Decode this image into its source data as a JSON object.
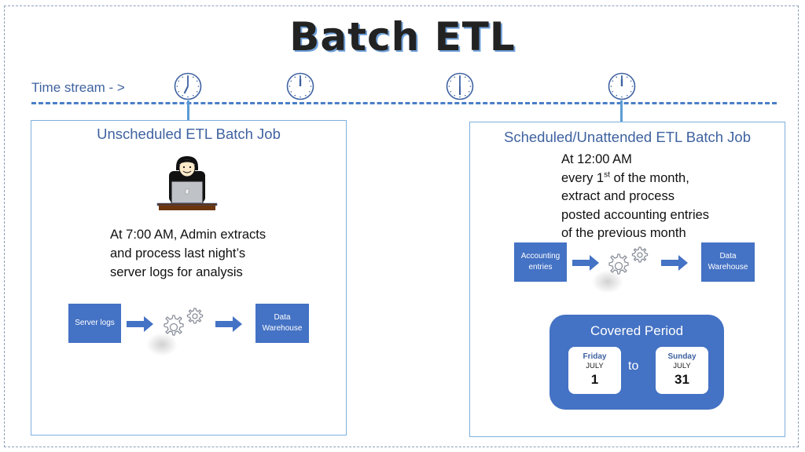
{
  "title": "Batch ETL",
  "timeline": {
    "label": "Time stream - >",
    "clocks": [
      {
        "icon": "clock-icon",
        "time": "7:00"
      },
      {
        "icon": "clock-icon",
        "time": "12:00"
      },
      {
        "icon": "clock-icon",
        "time": "6:00"
      },
      {
        "icon": "clock-icon",
        "time": "12:00"
      }
    ]
  },
  "unscheduled": {
    "title": "Unscheduled ETL Batch Job",
    "icon": "admin-at-laptop-icon",
    "description": [
      "At 7:00 AM, Admin extracts",
      "and process last night’s",
      "server logs for analysis"
    ],
    "flow": {
      "source": "Server logs",
      "process_icon": "gears-icon",
      "target_line1": "Data",
      "target_line2": "Warehouse"
    }
  },
  "scheduled": {
    "title": "Scheduled/Unattended ETL Batch Job",
    "description": {
      "line1": "At 12:00 AM",
      "line2_pre": "every 1",
      "line2_sup": "st",
      "line2_post": " of the month,",
      "line3": "extract and process",
      "line4": "posted accounting entries",
      "line5": "of the previous month"
    },
    "flow": {
      "source_line1": "Accounting",
      "source_line2": "entries",
      "process_icon": "gears-icon",
      "target_line1": "Data",
      "target_line2": "Warehouse"
    },
    "covered_period": {
      "title": "Covered Period",
      "from": {
        "day": "Friday",
        "month": "JULY",
        "date": "1"
      },
      "separator": "to",
      "to": {
        "day": "Sunday",
        "month": "JULY",
        "date": "31"
      }
    }
  },
  "colors": {
    "accent": "#4472c4",
    "title_text": "#3f62a0",
    "panel_border": "#7fb0dd"
  }
}
